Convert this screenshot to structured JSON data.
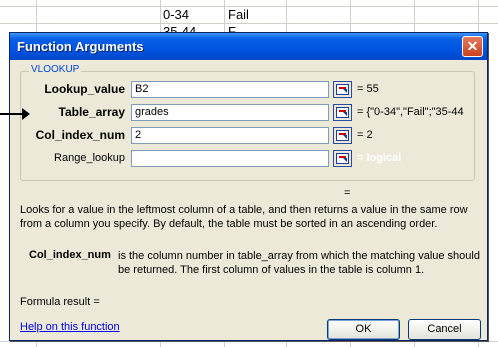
{
  "sheet": {
    "row1": {
      "range": "0-34",
      "grade": "Fail"
    },
    "row2": {
      "range": "35-44",
      "grade": "F"
    }
  },
  "dialog": {
    "title": "Function Arguments",
    "close_label": "✕",
    "function_name": "VLOOKUP",
    "args": [
      {
        "label": "Lookup_value",
        "value": "B2",
        "result": "= 55",
        "bold": true
      },
      {
        "label": "Table_array",
        "value": "grades",
        "result": "= {\"0-34\",\"Fail\";\"35-44",
        "bold": true
      },
      {
        "label": "Col_index_num",
        "value": "2",
        "result": "= 2",
        "bold": true
      },
      {
        "label": "Range_lookup",
        "value": "",
        "result": "= logical",
        "bold": false
      }
    ],
    "function_result": "=",
    "description": "Looks for a value in the leftmost column of a table, and then returns a value in the same row from a column you specify. By default, the table must be sorted in an ascending order.",
    "arg_desc_name": "Col_index_num",
    "arg_desc_text": "is the column number in table_array from which the matching value should be returned. The first column of values in the table is column 1.",
    "formula_result_label": "Formula result =",
    "help_link": "Help on this function",
    "ok_label": "OK",
    "cancel_label": "Cancel"
  },
  "colors": {
    "titlebar": "#0054e3",
    "dialog_bg": "#ece9d8",
    "link": "#0000ee",
    "group_label": "#0046d5"
  },
  "icons": [
    "collapse-dialog-icon",
    "close-icon",
    "arrow-pointer-icon"
  ]
}
